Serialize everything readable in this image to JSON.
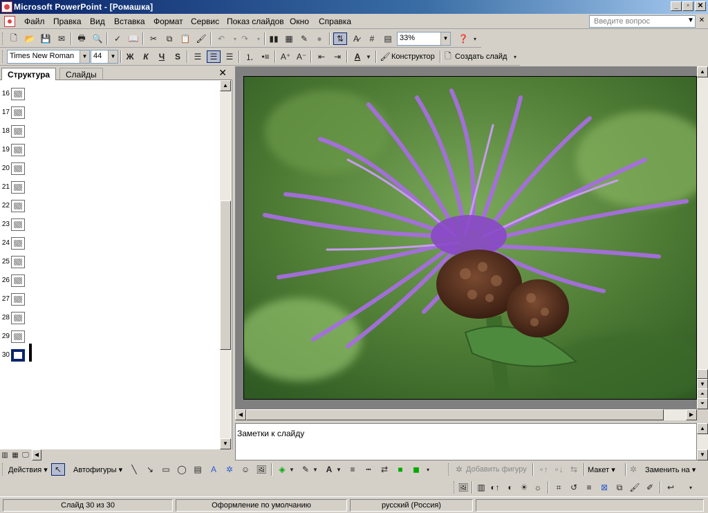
{
  "window": {
    "title": "Microsoft PowerPoint - [Ромашка]"
  },
  "menu": {
    "items": [
      "Файл",
      "Правка",
      "Вид",
      "Вставка",
      "Формат",
      "Сервис",
      "Показ слайдов",
      "Окно",
      "Справка"
    ],
    "help_placeholder": "Введите вопрос"
  },
  "toolbar_standard": {
    "zoom": "33%"
  },
  "toolbar_formatting": {
    "font_name": "Times New Roman",
    "font_size": "44",
    "bold": "Ж",
    "italic": "К",
    "underline": "Ч",
    "shadow": "S",
    "designer": "Конструктор",
    "new_slide": "Создать слайд"
  },
  "left_pane": {
    "tabs": {
      "outline": "Структура",
      "slides": "Слайды"
    },
    "slide_numbers": [
      "16",
      "17",
      "18",
      "19",
      "20",
      "21",
      "22",
      "23",
      "24",
      "25",
      "26",
      "27",
      "28",
      "29",
      "30"
    ],
    "active_slide": "30"
  },
  "notes": {
    "placeholder": "Заметки к слайду"
  },
  "drawing_toolbar": {
    "actions": "Действия",
    "autoshapes": "Автофигуры"
  },
  "org_toolbar": {
    "add_shape": "Добавить фигуру",
    "layout": "Макет",
    "replace": "Заменить на"
  },
  "status": {
    "slide": "Слайд 30 из 30",
    "design": "Оформление по умолчанию",
    "language": "русский (Россия)"
  },
  "colors": {
    "title_bar": "#0a246a",
    "flower": "#9b59d0",
    "bud": "#5a3020"
  }
}
